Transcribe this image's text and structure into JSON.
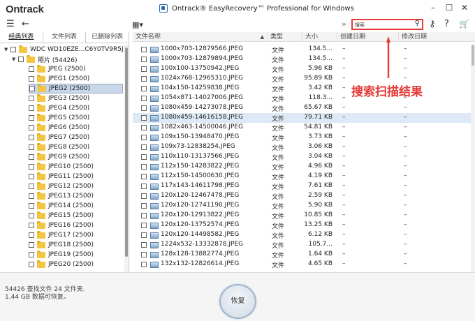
{
  "app": {
    "logo": "Ontrack",
    "title": "Ontrack® EasyRecovery™ Professional for Windows",
    "window_controls": [
      "–",
      "☐",
      "✕"
    ]
  },
  "toolbar": {
    "search_value": "搜索",
    "icons": [
      "menu-icon",
      "back-arrow-icon",
      "view-grid-icon",
      "double-chevron-icon",
      "search-icon",
      "key-icon",
      "help-icon",
      "cart-icon"
    ]
  },
  "left": {
    "tabs": [
      "经典列表",
      "文件列表",
      "已删除列表"
    ],
    "tree": [
      {
        "label": "WDC WD10EZE...C6Y0TV9R5J)",
        "level": 0,
        "expanded": true
      },
      {
        "label": "照片 (54426)",
        "level": 1,
        "expanded": true
      },
      {
        "label": "JPEG (2500)",
        "level": 2
      },
      {
        "label": "JPEG1 (2500)",
        "level": 2
      },
      {
        "label": "JPEG2 (2500)",
        "level": 2,
        "selected": true
      },
      {
        "label": "JPEG3 (2500)",
        "level": 2
      },
      {
        "label": "JPEG4 (2500)",
        "level": 2
      },
      {
        "label": "JPEG5 (2500)",
        "level": 2
      },
      {
        "label": "JPEG6 (2500)",
        "level": 2
      },
      {
        "label": "JPEG7 (2500)",
        "level": 2
      },
      {
        "label": "JPEG8 (2500)",
        "level": 2
      },
      {
        "label": "JPEG9 (2500)",
        "level": 2
      },
      {
        "label": "JPEG10 (2500)",
        "level": 2
      },
      {
        "label": "JPEG11 (2500)",
        "level": 2
      },
      {
        "label": "JPEG12 (2500)",
        "level": 2
      },
      {
        "label": "JPEG13 (2500)",
        "level": 2
      },
      {
        "label": "JPEG14 (2500)",
        "level": 2
      },
      {
        "label": "JPEG15 (2500)",
        "level": 2
      },
      {
        "label": "JPEG16 (2500)",
        "level": 2
      },
      {
        "label": "JPEG17 (2500)",
        "level": 2
      },
      {
        "label": "JPEG18 (2500)",
        "level": 2
      },
      {
        "label": "JPEG19 (2500)",
        "level": 2
      },
      {
        "label": "JPEG20 (2500)",
        "level": 2
      }
    ]
  },
  "table": {
    "headers": [
      "文件名称",
      "类型",
      "大小",
      "创建日期",
      "修改日期"
    ],
    "rows": [
      {
        "name": "1000x703-12879566.JPEG",
        "type": "文件",
        "size": "134.5...",
        "created": "–",
        "modified": "–"
      },
      {
        "name": "1000x703-12879894.JPEG",
        "type": "文件",
        "size": "134.5...",
        "created": "–",
        "modified": "–"
      },
      {
        "name": "100x100-13750942.JPEG",
        "type": "文件",
        "size": "5.96 KB",
        "created": "–",
        "modified": "–"
      },
      {
        "name": "1024x768-12965310.JPEG",
        "type": "文件",
        "size": "95.89 KB",
        "created": "–",
        "modified": "–"
      },
      {
        "name": "104x150-14259838.JPEG",
        "type": "文件",
        "size": "3.42 KB",
        "created": "–",
        "modified": "–"
      },
      {
        "name": "1054x871-14027006.JPEG",
        "type": "文件",
        "size": "118.3...",
        "created": "–",
        "modified": "–"
      },
      {
        "name": "1080x459-14273078.JPEG",
        "type": "文件",
        "size": "65.67 KB",
        "created": "–",
        "modified": "–"
      },
      {
        "name": "1080x459-14616158.JPEG",
        "type": "文件",
        "size": "79.71 KB",
        "created": "–",
        "modified": "–",
        "selected": true
      },
      {
        "name": "1082x463-14500046.JPEG",
        "type": "文件",
        "size": "54.81 KB",
        "created": "–",
        "modified": "–"
      },
      {
        "name": "109x150-13948470.JPEG",
        "type": "文件",
        "size": "3.73 KB",
        "created": "–",
        "modified": "–"
      },
      {
        "name": "109x73-12838254.JPEG",
        "type": "文件",
        "size": "3.06 KB",
        "created": "–",
        "modified": "–"
      },
      {
        "name": "110x110-13137566.JPEG",
        "type": "文件",
        "size": "3.04 KB",
        "created": "–",
        "modified": "–"
      },
      {
        "name": "112x150-14283822.JPEG",
        "type": "文件",
        "size": "4.96 KB",
        "created": "–",
        "modified": "–"
      },
      {
        "name": "112x150-14500630.JPEG",
        "type": "文件",
        "size": "4.19 KB",
        "created": "–",
        "modified": "–"
      },
      {
        "name": "117x143-14611798.JPEG",
        "type": "文件",
        "size": "7.61 KB",
        "created": "–",
        "modified": "–"
      },
      {
        "name": "120x120-12467478.JPEG",
        "type": "文件",
        "size": "2.59 KB",
        "created": "–",
        "modified": "–"
      },
      {
        "name": "120x120-12741190.JPEG",
        "type": "文件",
        "size": "5.90 KB",
        "created": "–",
        "modified": "–"
      },
      {
        "name": "120x120-12913822.JPEG",
        "type": "文件",
        "size": "10.85 KB",
        "created": "–",
        "modified": "–"
      },
      {
        "name": "120x120-13752574.JPEG",
        "type": "文件",
        "size": "13.25 KB",
        "created": "–",
        "modified": "–"
      },
      {
        "name": "120x120-14498582.JPEG",
        "type": "文件",
        "size": "6.12 KB",
        "created": "–",
        "modified": "–"
      },
      {
        "name": "1224x532-13332878.JPEG",
        "type": "文件",
        "size": "105.7...",
        "created": "–",
        "modified": "–"
      },
      {
        "name": "128x128-13882774.JPEG",
        "type": "文件",
        "size": "1.64 KB",
        "created": "–",
        "modified": "–"
      },
      {
        "name": "132x132-12826614.JPEG",
        "type": "文件",
        "size": "4.65 KB",
        "created": "–",
        "modified": "–"
      }
    ]
  },
  "annotation": {
    "text": "搜索扫描结果",
    "color": "#e53935"
  },
  "footer": {
    "status_line1": "54426 查找文件 24 文件夹.",
    "status_line2": "1.44 GB 数据可恢复。",
    "recover_label": "恢复"
  }
}
